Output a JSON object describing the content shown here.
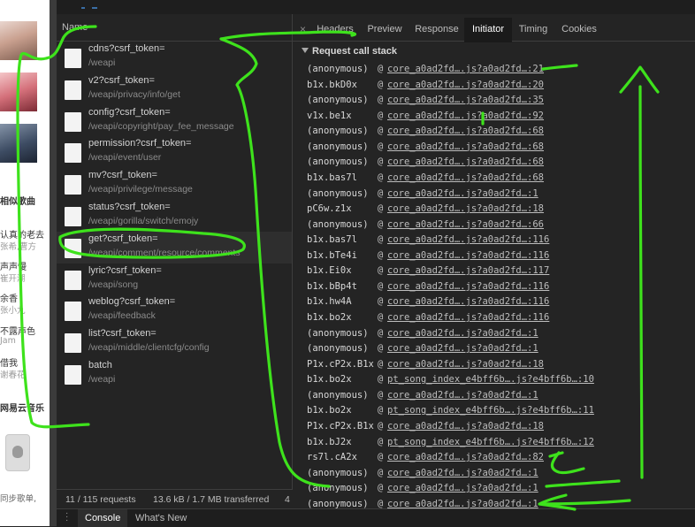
{
  "left_page": {
    "items": [
      {
        "text": "相似歌曲",
        "bold": true
      },
      {
        "text": "认真的老去",
        "sub": "张希,曹方"
      },
      {
        "text": "声声慢",
        "sub": "崔开潮"
      },
      {
        "text": "余香",
        "sub": "张小九"
      },
      {
        "text": "不露声色",
        "sub": "Jam"
      },
      {
        "text": "借我",
        "sub": "谢春花"
      },
      {
        "text": "网易云音乐",
        "bold": true
      },
      {
        "text": "同步歌单,"
      }
    ]
  },
  "network": {
    "name_header": "Name",
    "requests": [
      {
        "name": "cdns?csrf_token=",
        "path": "/weapi"
      },
      {
        "name": "v2?csrf_token=",
        "path": "/weapi/privacy/info/get"
      },
      {
        "name": "config?csrf_token=",
        "path": "/weapi/copyright/pay_fee_message"
      },
      {
        "name": "permission?csrf_token=",
        "path": "/weapi/event/user"
      },
      {
        "name": "mv?csrf_token=",
        "path": "/weapi/privilege/message"
      },
      {
        "name": "status?csrf_token=",
        "path": "/weapi/gorilla/switch/emojy"
      },
      {
        "name": "get?csrf_token=",
        "path": "/weapi/comment/resource/comments"
      },
      {
        "name": "lyric?csrf_token=",
        "path": "/weapi/song"
      },
      {
        "name": "weblog?csrf_token=",
        "path": "/weapi/feedback"
      },
      {
        "name": "list?csrf_token=",
        "path": "/weapi/middle/clientcfg/config"
      },
      {
        "name": "batch",
        "path": "/weapi"
      }
    ],
    "selected_index": 6,
    "status": {
      "requests": "11 / 115 requests",
      "transferred": "13.6 kB / 1.7 MB transferred",
      "extra": "4"
    }
  },
  "detail": {
    "close": "×",
    "tabs": [
      "Headers",
      "Preview",
      "Response",
      "Initiator",
      "Timing",
      "Cookies"
    ],
    "active_tab": "Initiator",
    "callstack_title": "Request call stack",
    "frames": [
      {
        "fn": "(anonymous)",
        "at": "@",
        "src": "core_a0ad2fd….js?a0ad2fd…:21"
      },
      {
        "fn": "b1x.bkD0x",
        "at": "@",
        "src": "core_a0ad2fd….js?a0ad2fd…:20"
      },
      {
        "fn": "(anonymous)",
        "at": "@",
        "src": "core_a0ad2fd….js?a0ad2fd…:35"
      },
      {
        "fn": "v1x.be1x",
        "at": "@",
        "src": "core_a0ad2fd….js?a0ad2fd…:92"
      },
      {
        "fn": "(anonymous)",
        "at": "@",
        "src": "core_a0ad2fd….js?a0ad2fd…:68"
      },
      {
        "fn": "(anonymous)",
        "at": "@",
        "src": "core_a0ad2fd….js?a0ad2fd…:68"
      },
      {
        "fn": "(anonymous)",
        "at": "@",
        "src": "core_a0ad2fd….js?a0ad2fd…:68"
      },
      {
        "fn": "b1x.bas7l",
        "at": "@",
        "src": "core_a0ad2fd….js?a0ad2fd…:68"
      },
      {
        "fn": "(anonymous)",
        "at": "@",
        "src": "core_a0ad2fd….js?a0ad2fd…:1"
      },
      {
        "fn": "pC6w.z1x",
        "at": "@",
        "src": "core_a0ad2fd….js?a0ad2fd…:18"
      },
      {
        "fn": "(anonymous)",
        "at": "@",
        "src": "core_a0ad2fd….js?a0ad2fd…:66"
      },
      {
        "fn": "b1x.bas7l",
        "at": "@",
        "src": "core_a0ad2fd….js?a0ad2fd…:116"
      },
      {
        "fn": "b1x.bTe4i",
        "at": "@",
        "src": "core_a0ad2fd….js?a0ad2fd…:116"
      },
      {
        "fn": "b1x.Ei0x",
        "at": "@",
        "src": "core_a0ad2fd….js?a0ad2fd…:117"
      },
      {
        "fn": "b1x.bBp4t",
        "at": "@",
        "src": "core_a0ad2fd….js?a0ad2fd…:116"
      },
      {
        "fn": "b1x.hw4A",
        "at": "@",
        "src": "core_a0ad2fd….js?a0ad2fd…:116"
      },
      {
        "fn": "b1x.bo2x",
        "at": "@",
        "src": "core_a0ad2fd….js?a0ad2fd…:116"
      },
      {
        "fn": "(anonymous)",
        "at": "@",
        "src": "core_a0ad2fd….js?a0ad2fd…:1"
      },
      {
        "fn": "(anonymous)",
        "at": "@",
        "src": "core_a0ad2fd….js?a0ad2fd…:1"
      },
      {
        "fn": "P1x.cP2x.B1x",
        "at": "@",
        "src": "core_a0ad2fd….js?a0ad2fd…:18"
      },
      {
        "fn": "b1x.bo2x",
        "at": "@",
        "src": "pt_song_index_e4bff6b….js?e4bff6b…:10"
      },
      {
        "fn": "(anonymous)",
        "at": "@",
        "src": "core_a0ad2fd….js?a0ad2fd…:1"
      },
      {
        "fn": "b1x.bo2x",
        "at": "@",
        "src": "pt_song_index_e4bff6b….js?e4bff6b…:11"
      },
      {
        "fn": "P1x.cP2x.B1x",
        "at": "@",
        "src": "core_a0ad2fd….js?a0ad2fd…:18"
      },
      {
        "fn": "b1x.bJ2x",
        "at": "@",
        "src": "pt_song_index_e4bff6b….js?e4bff6b…:12"
      },
      {
        "fn": "rs7l.cA2x",
        "at": "@",
        "src": "core_a0ad2fd….js?a0ad2fd…:82"
      },
      {
        "fn": "(anonymous)",
        "at": "@",
        "src": "core_a0ad2fd….js?a0ad2fd…:1"
      },
      {
        "fn": "(anonymous)",
        "at": "@",
        "src": "core_a0ad2fd….js?a0ad2fd…:1"
      },
      {
        "fn": "(anonymous)",
        "at": "@",
        "src": "core_a0ad2fd….js?a0ad2fd…:1"
      }
    ]
  },
  "drawer": {
    "menu_icon": "more-vertical-icon",
    "tabs": [
      "Console",
      "What's New"
    ],
    "active_tab": "Console"
  },
  "colors": {
    "annotation": "#3ee21c",
    "selected_tab_bg": "#1a1a1a",
    "panel_bg": "#242424"
  }
}
